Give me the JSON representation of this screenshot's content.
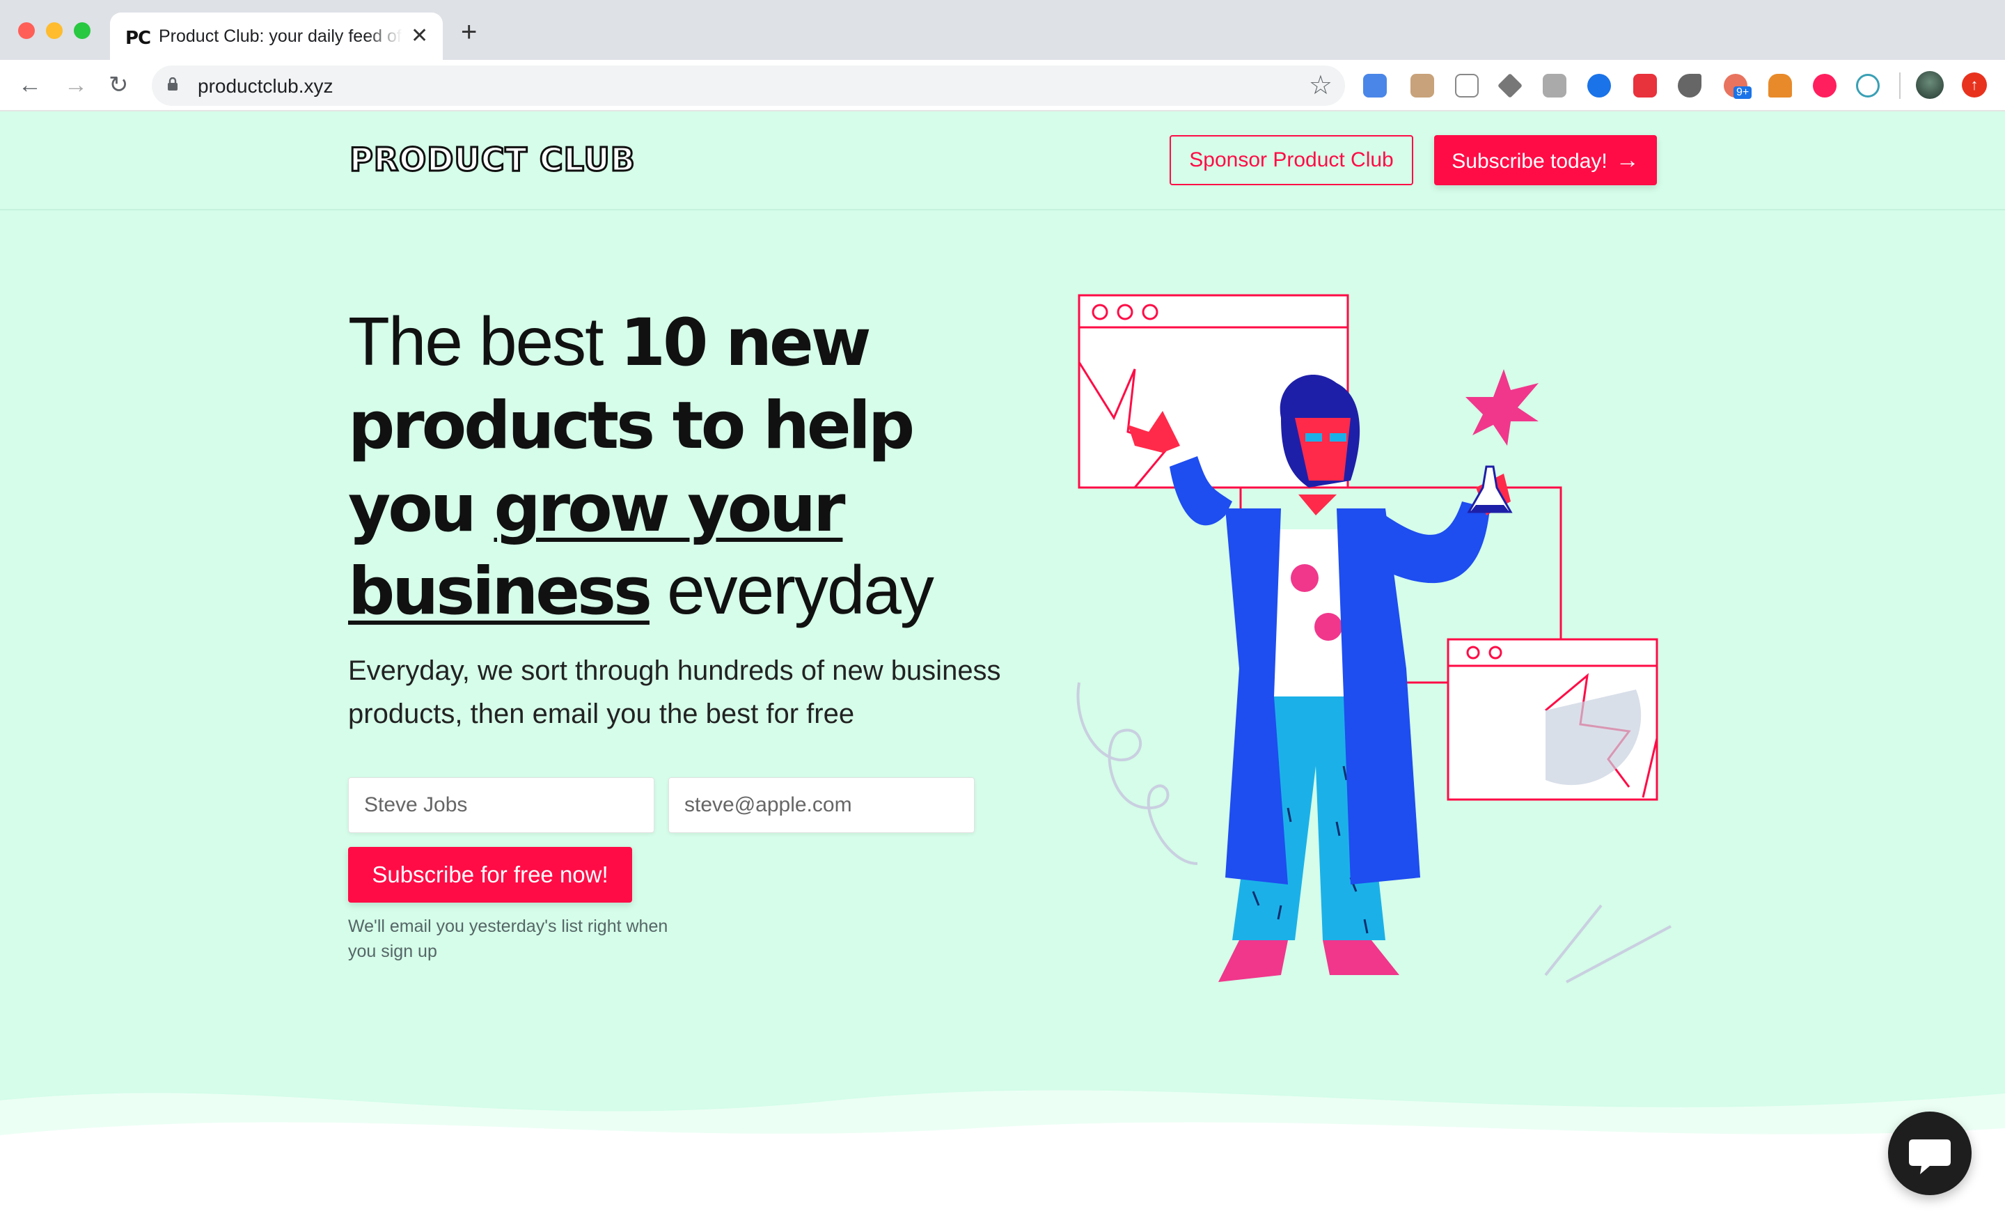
{
  "browser": {
    "tab_favicon": "PC",
    "tab_title": "Product Club: your daily feed of",
    "tab_close": "✕",
    "new_tab": "+",
    "back": "←",
    "forward": "→",
    "reload": "↻",
    "url": "productclub.xyz",
    "bookmark": "☆",
    "extension_badge": "9+",
    "extensions": [
      "google-translate-icon",
      "box-icon",
      "page-icon",
      "drive-icon",
      "h-icon",
      "bank-icon",
      "red-box-icon",
      "bird-icon",
      "notification-icon",
      "fox-icon",
      "t-icon",
      "react-icon"
    ]
  },
  "header": {
    "logo": "PRODUCT CLUB",
    "sponsor_label": "Sponsor Product Club",
    "subscribe_label": "Subscribe today!",
    "subscribe_arrow": "→"
  },
  "hero": {
    "h_part1": "The best ",
    "h_bold1": "10 new products to help you ",
    "h_underline": "grow your business",
    "h_part2": " everyday",
    "subtitle": "Everyday, we sort through hundreds of new business products, then email you the best for free",
    "name_placeholder": "Steve Jobs",
    "email_placeholder": "steve@apple.com",
    "cta_label": "Subscribe for free now!",
    "note": "We'll email you yesterday's list right when you sign up"
  },
  "colors": {
    "accent": "#ff0c46",
    "background": "#d5fde9",
    "coat": "#1e4df0",
    "pants": "#1bb1e8",
    "pink": "#f0378c"
  }
}
